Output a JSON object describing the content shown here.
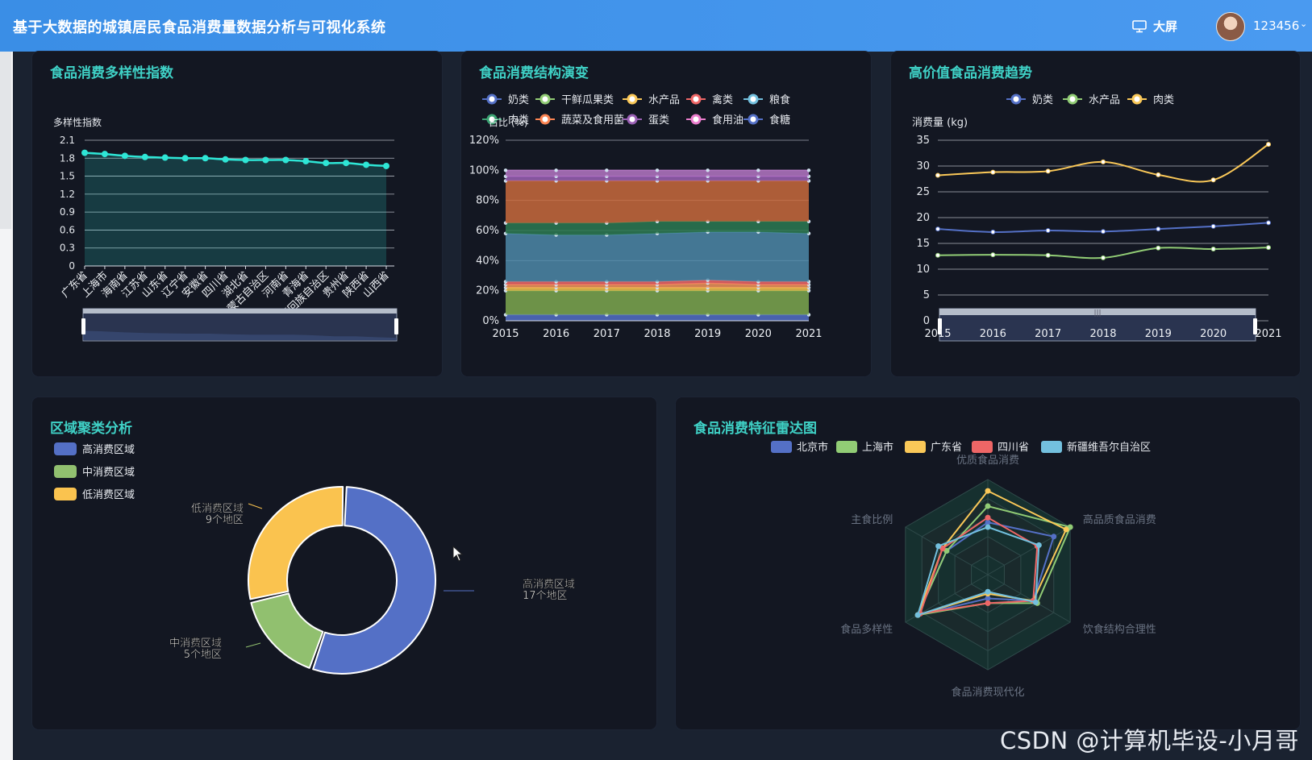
{
  "header": {
    "title": "基于大数据的城镇居民食品消费量数据分析与可视化系统",
    "bigscreen_label": "大屏",
    "username": "123456"
  },
  "panels": {
    "diversity": {
      "title": "食品消费多样性指数"
    },
    "structure": {
      "title": "食品消费结构演变"
    },
    "highvalue": {
      "title": "高价值食品消费趋势"
    },
    "cluster": {
      "title": "区域聚类分析"
    },
    "radar": {
      "title": "食品消费特征雷达图"
    }
  },
  "watermark": "CSDN @计算机毕设-小月哥",
  "chart_data": [
    {
      "id": "diversity",
      "type": "area",
      "ylabel": "多样性指数",
      "ylim": [
        0,
        2.1
      ],
      "yticks": [
        "0",
        "0.3",
        "0.6",
        "0.9",
        "1.2",
        "1.5",
        "1.8",
        "2.1"
      ],
      "categories": [
        "广东省",
        "上海市",
        "海南省",
        "江苏省",
        "山东省",
        "辽宁省",
        "安徽省",
        "四川省",
        "湖北省",
        "内蒙古自治区",
        "河南省",
        "青海省",
        "宁夏回族自治区",
        "贵州省",
        "陕西省",
        "山西省"
      ],
      "values": [
        1.89,
        1.87,
        1.84,
        1.82,
        1.81,
        1.8,
        1.8,
        1.78,
        1.77,
        1.77,
        1.77,
        1.75,
        1.72,
        1.72,
        1.69,
        1.67
      ],
      "color": "#2ee6d6",
      "datazoom": true
    },
    {
      "id": "structure",
      "type": "area",
      "stacked": true,
      "ylabel": "占比 (%)",
      "yticks": [
        "0%",
        "20%",
        "40%",
        "60%",
        "80%",
        "100%",
        "120%"
      ],
      "ylim": [
        0,
        120
      ],
      "categories": [
        "2015",
        "2016",
        "2017",
        "2018",
        "2019",
        "2020",
        "2021"
      ],
      "legend": [
        "奶类",
        "干鲜瓜果类",
        "水产品",
        "禽类",
        "粮食",
        "肉类",
        "蔬菜及食用菌",
        "蛋类",
        "食用油",
        "食糖"
      ],
      "legend_colors": [
        "#5470c6",
        "#91cc75",
        "#fac858",
        "#ee6666",
        "#73c0de",
        "#3ba272",
        "#fc8452",
        "#9a60b4",
        "#ea7ccc",
        "#5470c6"
      ],
      "series": [
        {
          "name": "食糖",
          "values": [
            4,
            4,
            4,
            4,
            4,
            4,
            4
          ]
        },
        {
          "name": "干鲜瓜果类",
          "values": [
            16,
            16,
            16,
            16,
            16,
            16,
            16
          ]
        },
        {
          "name": "水产品",
          "values": [
            2,
            2,
            2,
            2,
            2,
            2,
            2
          ]
        },
        {
          "name": "奶类",
          "values": [
            2,
            2,
            2,
            2,
            3,
            2,
            2
          ]
        },
        {
          "name": "禽类",
          "values": [
            2,
            2,
            2,
            2,
            2,
            2,
            2
          ]
        },
        {
          "name": "粮食",
          "values": [
            32,
            31,
            31,
            32,
            32,
            33,
            32
          ]
        },
        {
          "name": "肉类",
          "values": [
            7,
            8,
            8,
            8,
            7,
            7,
            8
          ]
        },
        {
          "name": "蔬菜及食用菌",
          "values": [
            28,
            28,
            28,
            27,
            27,
            27,
            27
          ]
        },
        {
          "name": "蛋类",
          "values": [
            3,
            3,
            3,
            3,
            3,
            3,
            3
          ]
        },
        {
          "name": "食用油",
          "values": [
            4,
            4,
            4,
            4,
            4,
            4,
            4
          ]
        }
      ]
    },
    {
      "id": "highvalue",
      "type": "line",
      "ylabel": "消费量 (kg)",
      "ylim": [
        0,
        35
      ],
      "yticks": [
        "0",
        "5",
        "10",
        "15",
        "20",
        "25",
        "30",
        "35"
      ],
      "categories": [
        "2015",
        "2016",
        "2017",
        "2018",
        "2019",
        "2020",
        "2021"
      ],
      "legend": [
        "奶类",
        "水产品",
        "肉类"
      ],
      "series": [
        {
          "name": "奶类",
          "color": "#5470c6",
          "values": [
            17.8,
            17.2,
            17.5,
            17.3,
            17.8,
            18.3,
            19.0
          ]
        },
        {
          "name": "水产品",
          "color": "#91cc75",
          "values": [
            12.7,
            12.8,
            12.7,
            12.2,
            14.1,
            13.9,
            14.2
          ]
        },
        {
          "name": "肉类",
          "color": "#fac858",
          "values": [
            28.2,
            28.8,
            29.0,
            30.8,
            28.3,
            27.3,
            34.2
          ]
        }
      ],
      "datazoom": true
    },
    {
      "id": "cluster",
      "type": "pie",
      "legend": [
        "高消费区域",
        "中消费区域",
        "低消费区域"
      ],
      "slices": [
        {
          "name": "高消费区域",
          "value": 17,
          "label1": "高消费区域",
          "label2": "17个地区",
          "color": "#5470c6"
        },
        {
          "name": "中消费区域",
          "value": 5,
          "label1": "中消费区域",
          "label2": "5个地区",
          "color": "#91c06f"
        },
        {
          "name": "低消费区域",
          "value": 9,
          "label1": "低消费区域",
          "label2": "9个地区",
          "color": "#fac34f"
        }
      ]
    },
    {
      "id": "radar",
      "type": "radar",
      "indicators": [
        "优质食品消费",
        "高品质食品消费",
        "饮食结构合理性",
        "食品消费现代化",
        "食品多样性",
        "主食比例"
      ],
      "legend": [
        "北京市",
        "上海市",
        "广东省",
        "四川省",
        "新疆维吾尔自治区"
      ],
      "series": [
        {
          "name": "北京市",
          "color": "#5470c6",
          "values": [
            0.55,
            0.8,
            0.55,
            0.25,
            0.85,
            0.5
          ]
        },
        {
          "name": "上海市",
          "color": "#91cc75",
          "values": [
            0.72,
            1.0,
            0.6,
            0.3,
            0.85,
            0.5
          ]
        },
        {
          "name": "广东省",
          "color": "#fac858",
          "values": [
            0.88,
            0.95,
            0.55,
            0.2,
            0.85,
            0.55
          ]
        },
        {
          "name": "四川省",
          "color": "#ee6666",
          "values": [
            0.6,
            0.6,
            0.55,
            0.3,
            0.82,
            0.55
          ]
        },
        {
          "name": "新疆维吾尔自治区",
          "color": "#73c0de",
          "values": [
            0.5,
            0.62,
            0.58,
            0.18,
            0.85,
            0.6
          ]
        }
      ]
    }
  ]
}
